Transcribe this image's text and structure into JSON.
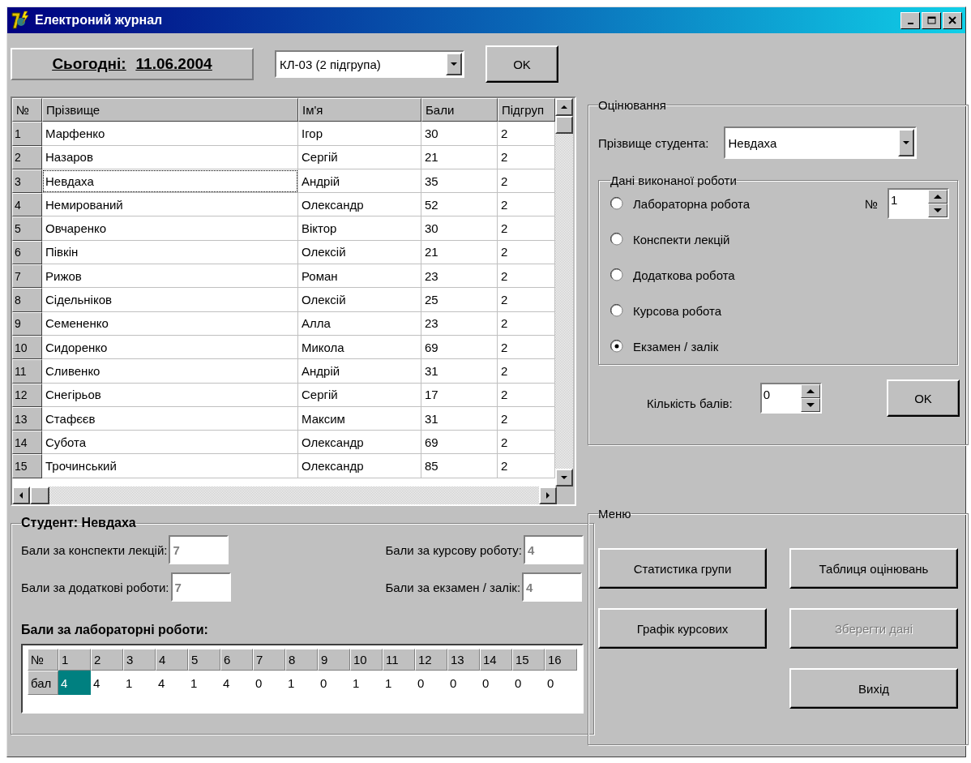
{
  "window": {
    "title": "Електроний журнал"
  },
  "today": {
    "label": "Сьогодні:",
    "date": "11.06.2004"
  },
  "group_select": {
    "value": "КЛ-03 (2 підгрупа)"
  },
  "group_ok": {
    "label": "OK"
  },
  "table": {
    "columns": [
      "№",
      "Прізвище",
      "Ім'я",
      "Бали",
      "Підгруп"
    ],
    "rows": [
      {
        "cells": [
          "1",
          "Марфенко",
          "Ігор",
          "30",
          "2"
        ],
        "focused": false
      },
      {
        "cells": [
          "2",
          "Назаров",
          "Сергій",
          "21",
          "2"
        ],
        "focused": false
      },
      {
        "cells": [
          "3",
          "Невдаха",
          "Андрій",
          "35",
          "2"
        ],
        "focused": true
      },
      {
        "cells": [
          "4",
          "Немирований",
          "Олександр",
          "52",
          "2"
        ],
        "focused": false
      },
      {
        "cells": [
          "5",
          "Овчаренко",
          "Віктор",
          "30",
          "2"
        ],
        "focused": false
      },
      {
        "cells": [
          "6",
          "Півкін",
          "Олексій",
          "21",
          "2"
        ],
        "focused": false
      },
      {
        "cells": [
          "7",
          "Рижов",
          "Роман",
          "23",
          "2"
        ],
        "focused": false
      },
      {
        "cells": [
          "8",
          "Сідельніков",
          "Олексій",
          "25",
          "2"
        ],
        "focused": false
      },
      {
        "cells": [
          "9",
          "Семененко",
          "Алла",
          "23",
          "2"
        ],
        "focused": false
      },
      {
        "cells": [
          "10",
          "Сидоренко",
          "Микола",
          "69",
          "2"
        ],
        "focused": false
      },
      {
        "cells": [
          "11",
          "Сливенко",
          "Андрій",
          "31",
          "2"
        ],
        "focused": false
      },
      {
        "cells": [
          "12",
          "Снегірьов",
          "Сергій",
          "17",
          "2"
        ],
        "focused": false
      },
      {
        "cells": [
          "13",
          "Стафєєв",
          "Максим",
          "31",
          "2"
        ],
        "focused": false
      },
      {
        "cells": [
          "14",
          "Субота",
          "Олександр",
          "69",
          "2"
        ],
        "focused": false
      },
      {
        "cells": [
          "15",
          "Трочинський",
          "Олександр",
          "85",
          "2"
        ],
        "focused": false
      }
    ]
  },
  "student": {
    "title": "Студент: Невдаха",
    "fields": [
      {
        "label": "Бали за конспекти лекцій:",
        "value": "7",
        "disabled": true
      },
      {
        "label": "Бали за курсову роботу:",
        "value": "4",
        "disabled": true
      },
      {
        "label": "Бали за додаткові роботи:",
        "value": "7",
        "disabled": true
      },
      {
        "label": "Бали за екзамен / залік:",
        "value": "4",
        "disabled": true
      }
    ],
    "labs_title": "Бали за лабораторні роботи:",
    "labs": {
      "header_label": "№",
      "row_label": "бал",
      "items": [
        {
          "number": "1",
          "score": "4",
          "selected": true
        },
        {
          "number": "2",
          "score": "4",
          "selected": false
        },
        {
          "number": "3",
          "score": "1",
          "selected": false
        },
        {
          "number": "4",
          "score": "4",
          "selected": false
        },
        {
          "number": "5",
          "score": "1",
          "selected": false
        },
        {
          "number": "6",
          "score": "4",
          "selected": false
        },
        {
          "number": "7",
          "score": "0",
          "selected": false
        },
        {
          "number": "8",
          "score": "1",
          "selected": false
        },
        {
          "number": "9",
          "score": "0",
          "selected": false
        },
        {
          "number": "10",
          "score": "1",
          "selected": false
        },
        {
          "number": "11",
          "score": "1",
          "selected": false
        },
        {
          "number": "12",
          "score": "0",
          "selected": false
        },
        {
          "number": "13",
          "score": "0",
          "selected": false
        },
        {
          "number": "14",
          "score": "0",
          "selected": false
        },
        {
          "number": "15",
          "score": "0",
          "selected": false
        },
        {
          "number": "16",
          "score": "0",
          "selected": false
        }
      ]
    }
  },
  "grading": {
    "title": "Оцінювання",
    "student_label": "Прізвище студента:",
    "student_value": "Невдаха",
    "work": {
      "title": "Дані виконаної роботи",
      "options": [
        {
          "label": "Лабораторна робота",
          "selected": false
        },
        {
          "label": "Конспекти лекцій",
          "selected": false
        },
        {
          "label": "Додаткова робота",
          "selected": false
        },
        {
          "label": "Курсова робота",
          "selected": false
        },
        {
          "label": "Екзамен / залік",
          "selected": true
        }
      ],
      "number_label": "№",
      "number_value": "1"
    },
    "points_label": "Кількість балів:",
    "points_value": "0",
    "ok": "OK"
  },
  "menu": {
    "title": "Меню",
    "buttons": [
      {
        "label": "Статистика групи",
        "disabled": false
      },
      {
        "label": "Таблиця оцінювань",
        "disabled": false
      },
      {
        "label": "Графік курсових",
        "disabled": false
      },
      {
        "label": "Зберегти дані",
        "disabled": true
      },
      {
        "label": "Вихід",
        "disabled": false
      }
    ]
  }
}
